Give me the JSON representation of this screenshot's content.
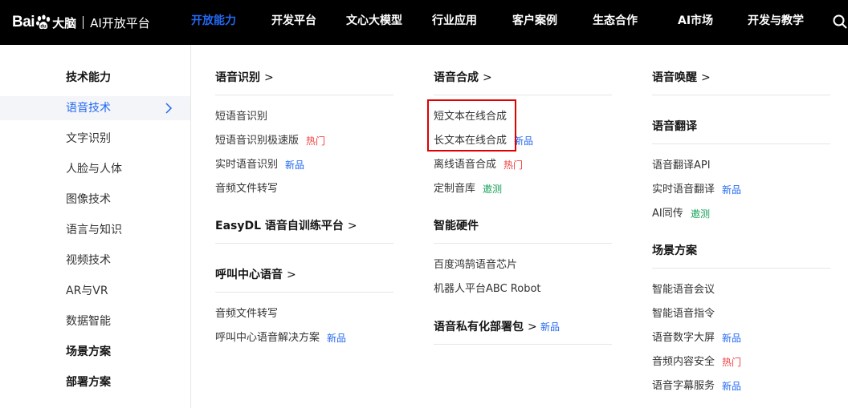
{
  "brand": {
    "logo_left": "Bai",
    "logo_right": "大脑",
    "platform": "AI开放平台"
  },
  "nav": [
    {
      "label": "开放能力",
      "active": true
    },
    {
      "label": "开发平台"
    },
    {
      "label": "文心大模型"
    },
    {
      "label": "行业应用"
    },
    {
      "label": "客户案例"
    },
    {
      "label": "生态合作"
    },
    {
      "label": "AI市场"
    },
    {
      "label": "开发与教学"
    }
  ],
  "sidebar": {
    "items": [
      {
        "label": "技术能力",
        "heading": true
      },
      {
        "label": "语音技术",
        "active": true
      },
      {
        "label": "文字识别"
      },
      {
        "label": "人脸与人体"
      },
      {
        "label": "图像技术"
      },
      {
        "label": "语言与知识"
      },
      {
        "label": "视频技术"
      },
      {
        "label": "AR与VR"
      },
      {
        "label": "数据智能"
      },
      {
        "label": "场景方案",
        "heading": true
      },
      {
        "label": "部署方案",
        "heading": true
      }
    ]
  },
  "badges": {
    "hot": "热门",
    "new": "新品",
    "test": "邀测"
  },
  "col1": {
    "speech_recognition": {
      "title": "语音识别",
      "links": [
        "短语音识别",
        "短语音识别极速版",
        "实时语音识别",
        "音频文件转写"
      ]
    },
    "easydl": {
      "title": "EasyDL 语音自训练平台"
    },
    "call_center": {
      "title": "呼叫中心语音",
      "links": [
        "音频文件转写",
        "呼叫中心语音解决方案"
      ]
    }
  },
  "col2": {
    "tts": {
      "title": "语音合成",
      "links": [
        "短文本在线合成",
        "长文本在线合成",
        "离线语音合成",
        "定制音库"
      ]
    },
    "hardware": {
      "title": "智能硬件",
      "links": [
        "百度鸿鹄语音芯片",
        "机器人平台ABC Robot"
      ]
    },
    "private": {
      "title": "语音私有化部署包"
    }
  },
  "col3": {
    "wakeup": {
      "title": "语音唤醒"
    },
    "translation": {
      "title": "语音翻译",
      "links": [
        "语音翻译API",
        "实时语音翻译",
        "AI同传"
      ]
    },
    "scenes": {
      "title": "场景方案",
      "links": [
        "智能语音会议",
        "智能语音指令",
        "语音数字大屏",
        "音频内容安全",
        "语音字幕服务"
      ]
    }
  },
  "colors": {
    "accent": "#2468f2",
    "hot": "#f33d3d",
    "test": "#18a058",
    "highlight": "#e00000"
  }
}
